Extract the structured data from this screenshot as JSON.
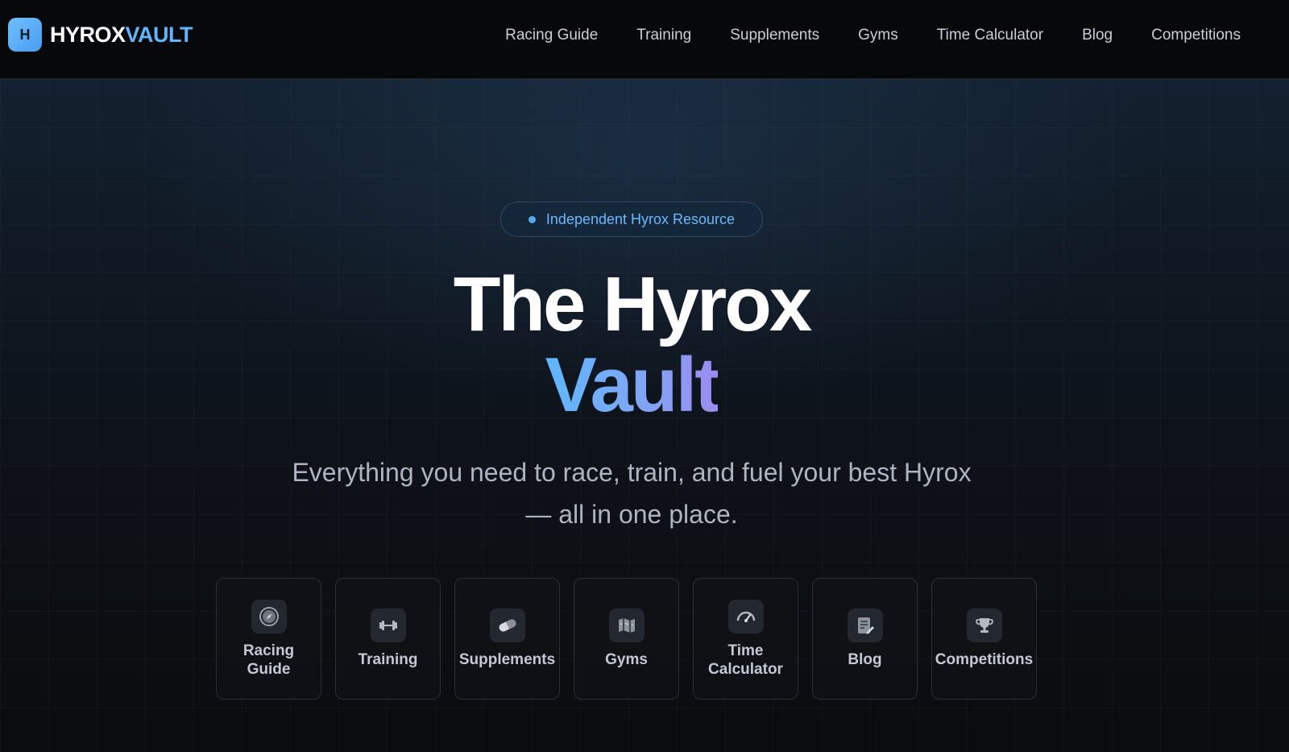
{
  "brand": {
    "badge_letter": "H",
    "name_part1": "HYROX",
    "name_part2": "VAULT"
  },
  "nav": {
    "links": [
      {
        "label": "Racing Guide"
      },
      {
        "label": "Training"
      },
      {
        "label": "Supplements"
      },
      {
        "label": "Gyms"
      },
      {
        "label": "Time Calculator"
      },
      {
        "label": "Blog"
      },
      {
        "label": "Competitions"
      }
    ]
  },
  "hero": {
    "badge": "Independent Hyrox Resource",
    "title_line1": "The Hyrox",
    "title_line2": "Vault",
    "subtitle": "Everything you need to race, train, and fuel your best Hyrox — all in one place."
  },
  "cards": [
    {
      "label": "Racing\nGuide",
      "icon": "compass-icon"
    },
    {
      "label": "Training",
      "icon": "dumbbell-icon"
    },
    {
      "label": "Supplements",
      "icon": "pill-icon"
    },
    {
      "label": "Gyms",
      "icon": "map-icon"
    },
    {
      "label": "Time\nCalculator",
      "icon": "speedometer-icon"
    },
    {
      "label": "Blog",
      "icon": "notepad-icon"
    },
    {
      "label": "Competitions",
      "icon": "trophy-icon"
    }
  ],
  "colors": {
    "accent": "#62b4ff",
    "gradient_end": "#9a8cf0",
    "nav_bg": "#07080a"
  }
}
